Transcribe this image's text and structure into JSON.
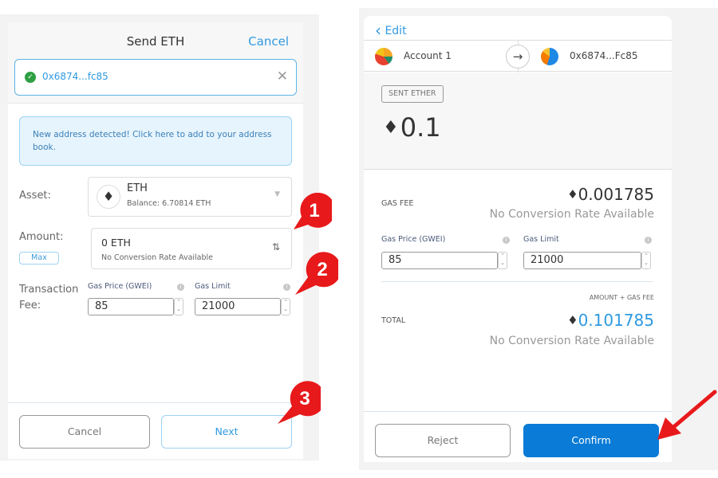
{
  "send_screen": {
    "title": "Send ETH",
    "cancel_link": "Cancel",
    "recipient": {
      "address": "0x6874...fc85",
      "status_icon": "check-circle-icon",
      "clear_icon": "close-icon"
    },
    "notice": "New address detected! Click here to add to your address book.",
    "asset": {
      "label": "Asset:",
      "name": "ETH",
      "balance": "Balance: 6.70814 ETH",
      "icon": "ethereum-icon"
    },
    "amount": {
      "label": "Amount:",
      "value": "0  ETH",
      "conversion": "No Conversion Rate Available",
      "max_label": "Max",
      "swap_icon": "⇅"
    },
    "fee": {
      "label_line1": "Transaction",
      "label_line2": "Fee:",
      "gas_price_label": "Gas Price (GWEI)",
      "gas_price_value": "85",
      "gas_limit_label": "Gas Limit",
      "gas_limit_value": "21000"
    },
    "buttons": {
      "cancel": "Cancel",
      "next": "Next"
    }
  },
  "confirm_screen": {
    "edit_link": "Edit",
    "from_account": "Account 1",
    "to_account": "0x6874...Fc85",
    "sent_badge": "SENT ETHER",
    "sent_amount": "0.1",
    "gas_fee": {
      "label": "GAS FEE",
      "value": "0.001785",
      "conversion": "No Conversion Rate Available"
    },
    "gas_price_label": "Gas Price (GWEI)",
    "gas_price_value": "85",
    "gas_limit_label": "Gas Limit",
    "gas_limit_value": "21000",
    "total": {
      "caption": "AMOUNT + GAS FEE",
      "label": "TOTAL",
      "value": "0.101785",
      "conversion": "No Conversion Rate Available"
    },
    "buttons": {
      "reject": "Reject",
      "confirm": "Confirm"
    }
  },
  "annotations": {
    "callouts": [
      "1",
      "2",
      "3"
    ],
    "color": "#e8191b"
  },
  "colors": {
    "accent": "#2f9ae0",
    "confirm": "#0a7bd6",
    "success": "#2ea043"
  },
  "glyphs": {
    "eth": "♦",
    "check": "✓",
    "close": "✕",
    "arrow_right": "→",
    "chevron_left": "‹",
    "caret_down": "▼"
  }
}
